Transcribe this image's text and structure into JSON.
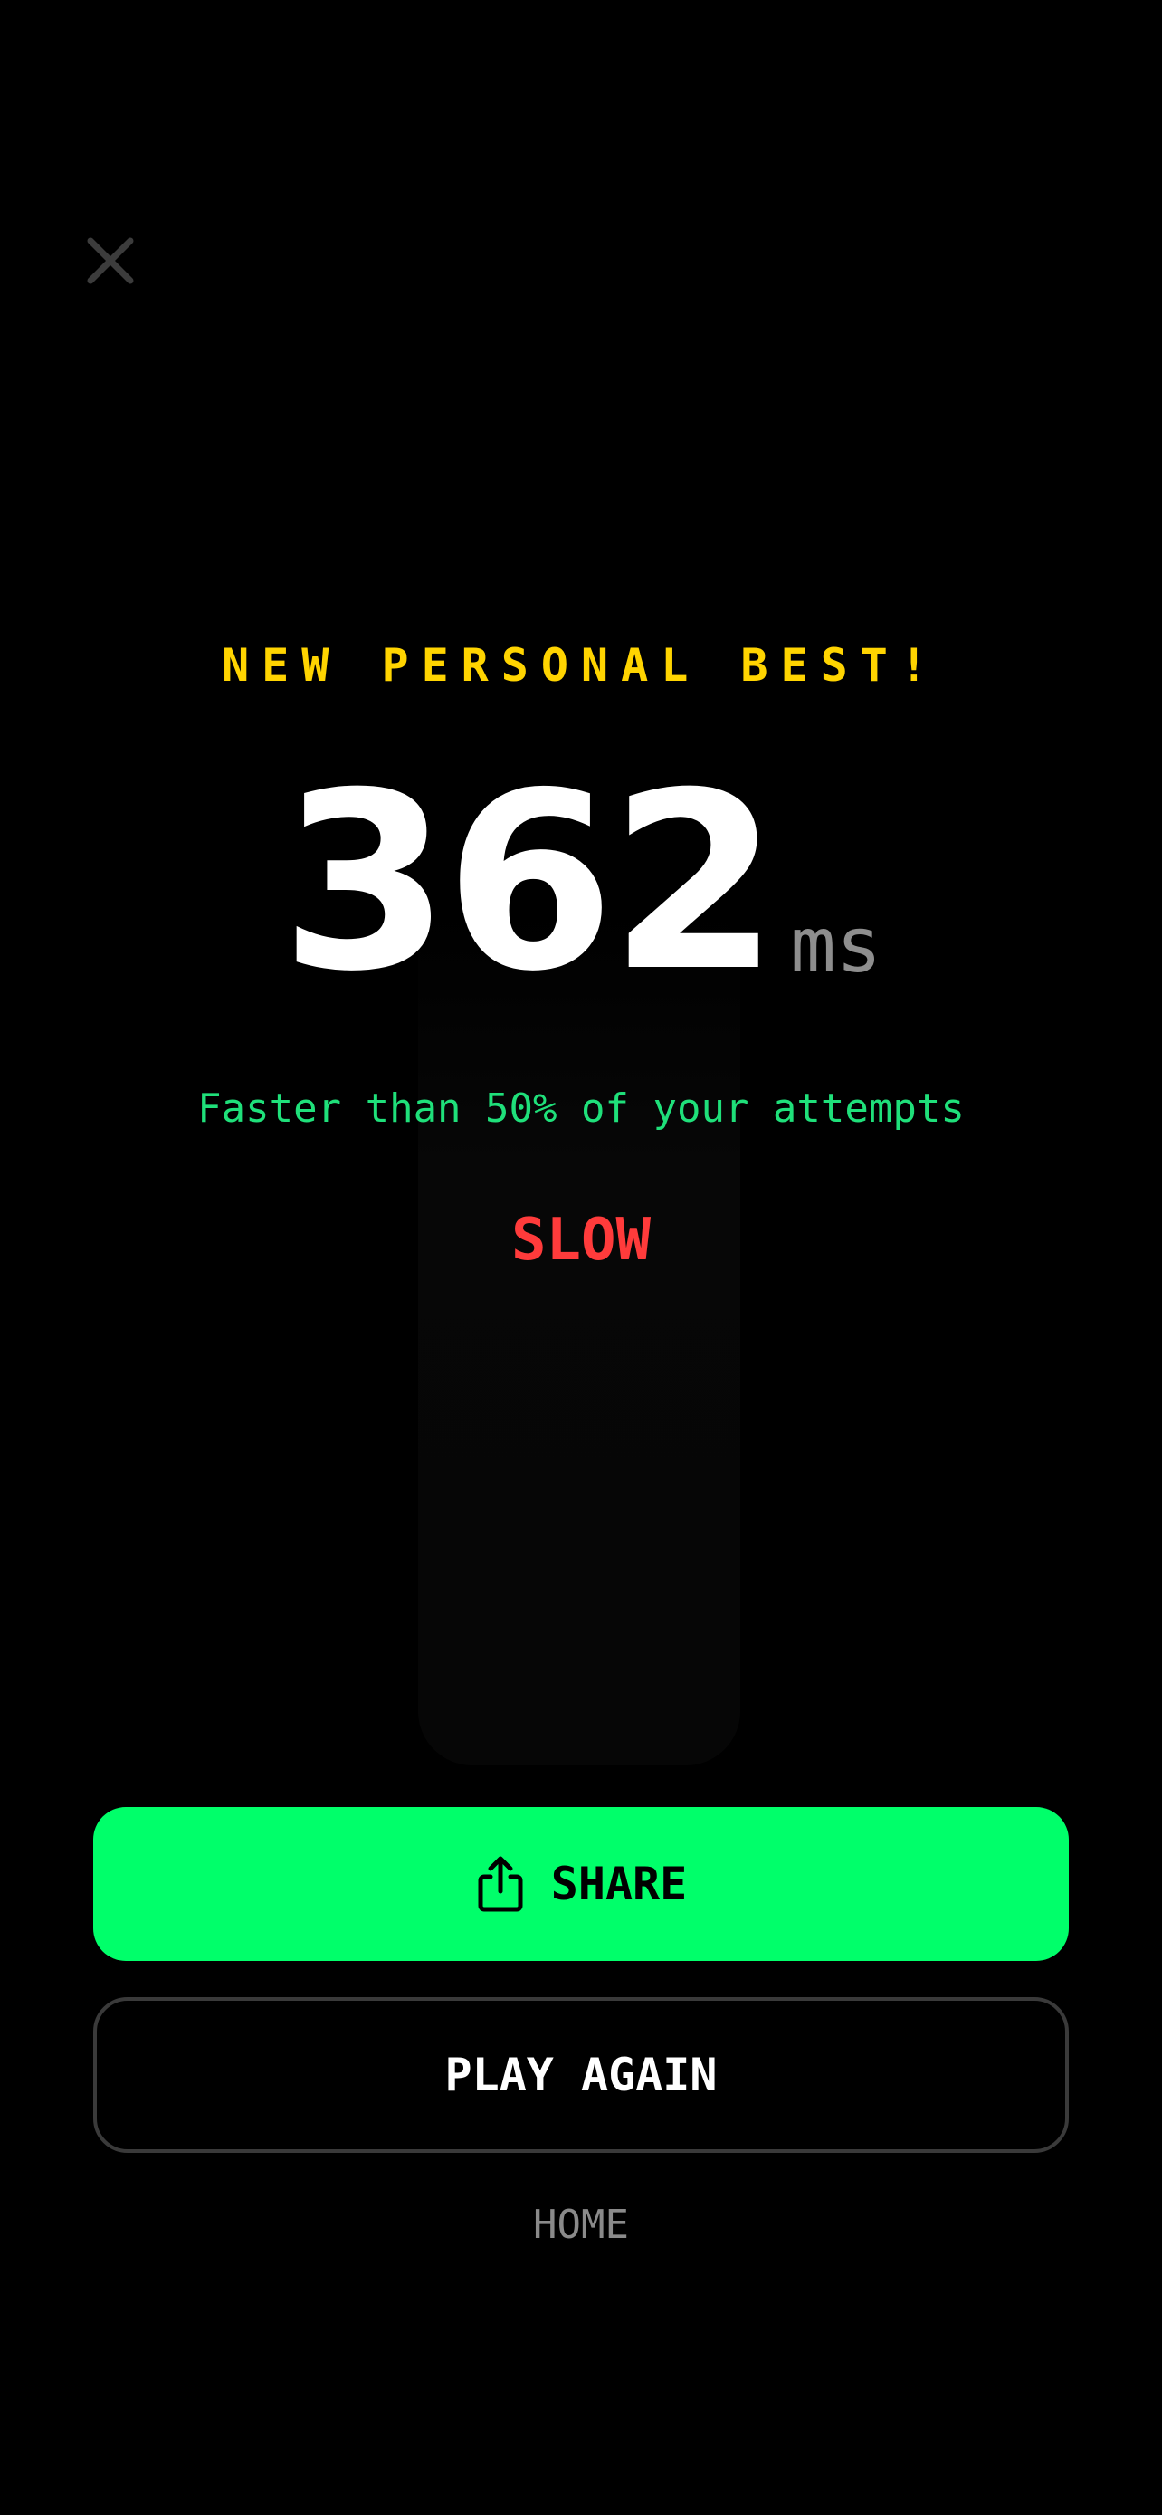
{
  "header": {
    "close_icon": "close-icon"
  },
  "result": {
    "banner": "NEW PERSONAL BEST!",
    "score": "362",
    "unit": "ms",
    "comparison": "Faster than 50% of your attempts",
    "rating": "SLOW"
  },
  "actions": {
    "share_label": "SHARE",
    "share_icon": "share-icon",
    "play_again_label": "PLAY AGAIN",
    "home_label": "HOME"
  },
  "colors": {
    "background": "#000000",
    "banner": "#ffd400",
    "comparison": "#1fe07a",
    "rating": "#ff3b3b",
    "primary_button": "#00ff6a",
    "unit": "#8e8e8e"
  }
}
